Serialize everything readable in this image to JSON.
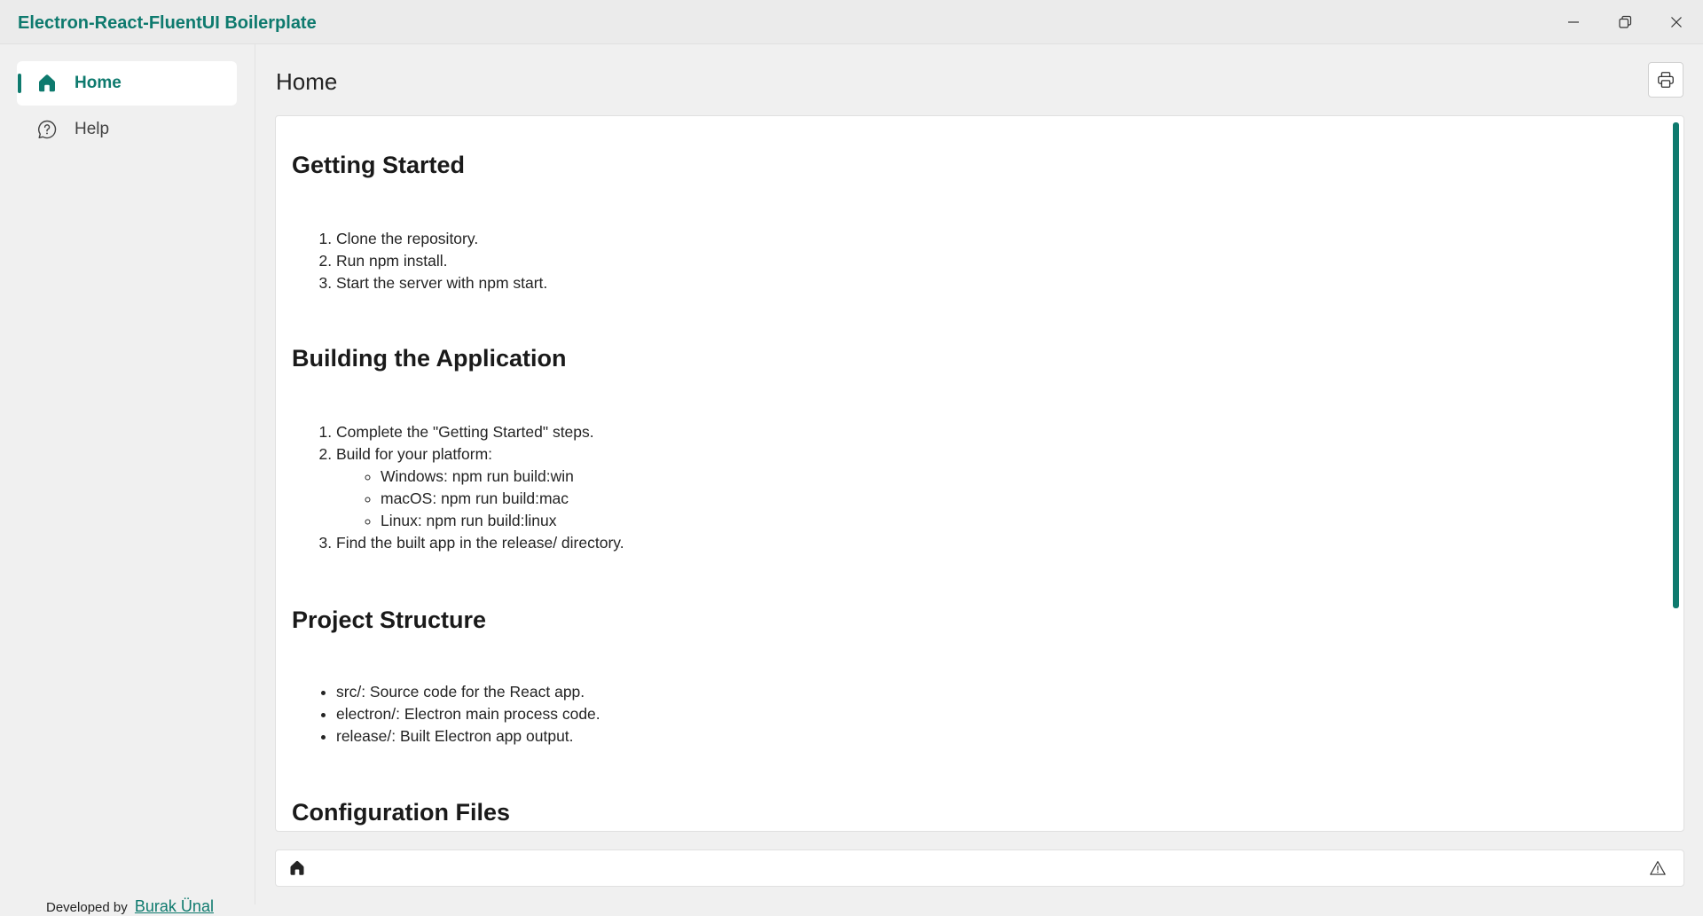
{
  "app": {
    "title": "Electron-React-FluentUI Boilerplate",
    "accent": "#0e7a6e"
  },
  "window_controls": {
    "minimize_icon": "minimize-icon",
    "restore_icon": "restore-icon",
    "close_icon": "close-icon"
  },
  "sidebar": {
    "items": [
      {
        "label": "Home",
        "icon": "home-icon",
        "active": true
      },
      {
        "label": "Help",
        "icon": "help-circle-icon",
        "active": false
      }
    ],
    "credit": {
      "prefix": "Developed by",
      "author": "Burak Ünal"
    }
  },
  "header": {
    "title": "Home",
    "print_icon": "print-icon"
  },
  "content": {
    "sections": [
      {
        "heading": "Getting Started",
        "list_type": "ordered",
        "items": [
          "Clone the repository.",
          "Run npm install.",
          "Start the server with npm start."
        ]
      },
      {
        "heading": "Building the Application",
        "list_type": "ordered",
        "items": [
          "Complete the \"Getting Started\" steps.",
          "Build for your platform:",
          "Find the built app in the release/ directory."
        ],
        "sub_items": [
          "Windows: npm run build:win",
          "macOS: npm run build:mac",
          "Linux: npm run build:linux"
        ]
      },
      {
        "heading": "Project Structure",
        "list_type": "unordered",
        "items": [
          "src/: Source code for the React app.",
          "electron/: Electron main process code.",
          "release/: Built Electron app output."
        ]
      },
      {
        "heading": "Configuration Files",
        "list_type": "none",
        "items": []
      }
    ]
  },
  "footer": {
    "left_icon": "home-icon",
    "right_icon": "warning-icon"
  }
}
